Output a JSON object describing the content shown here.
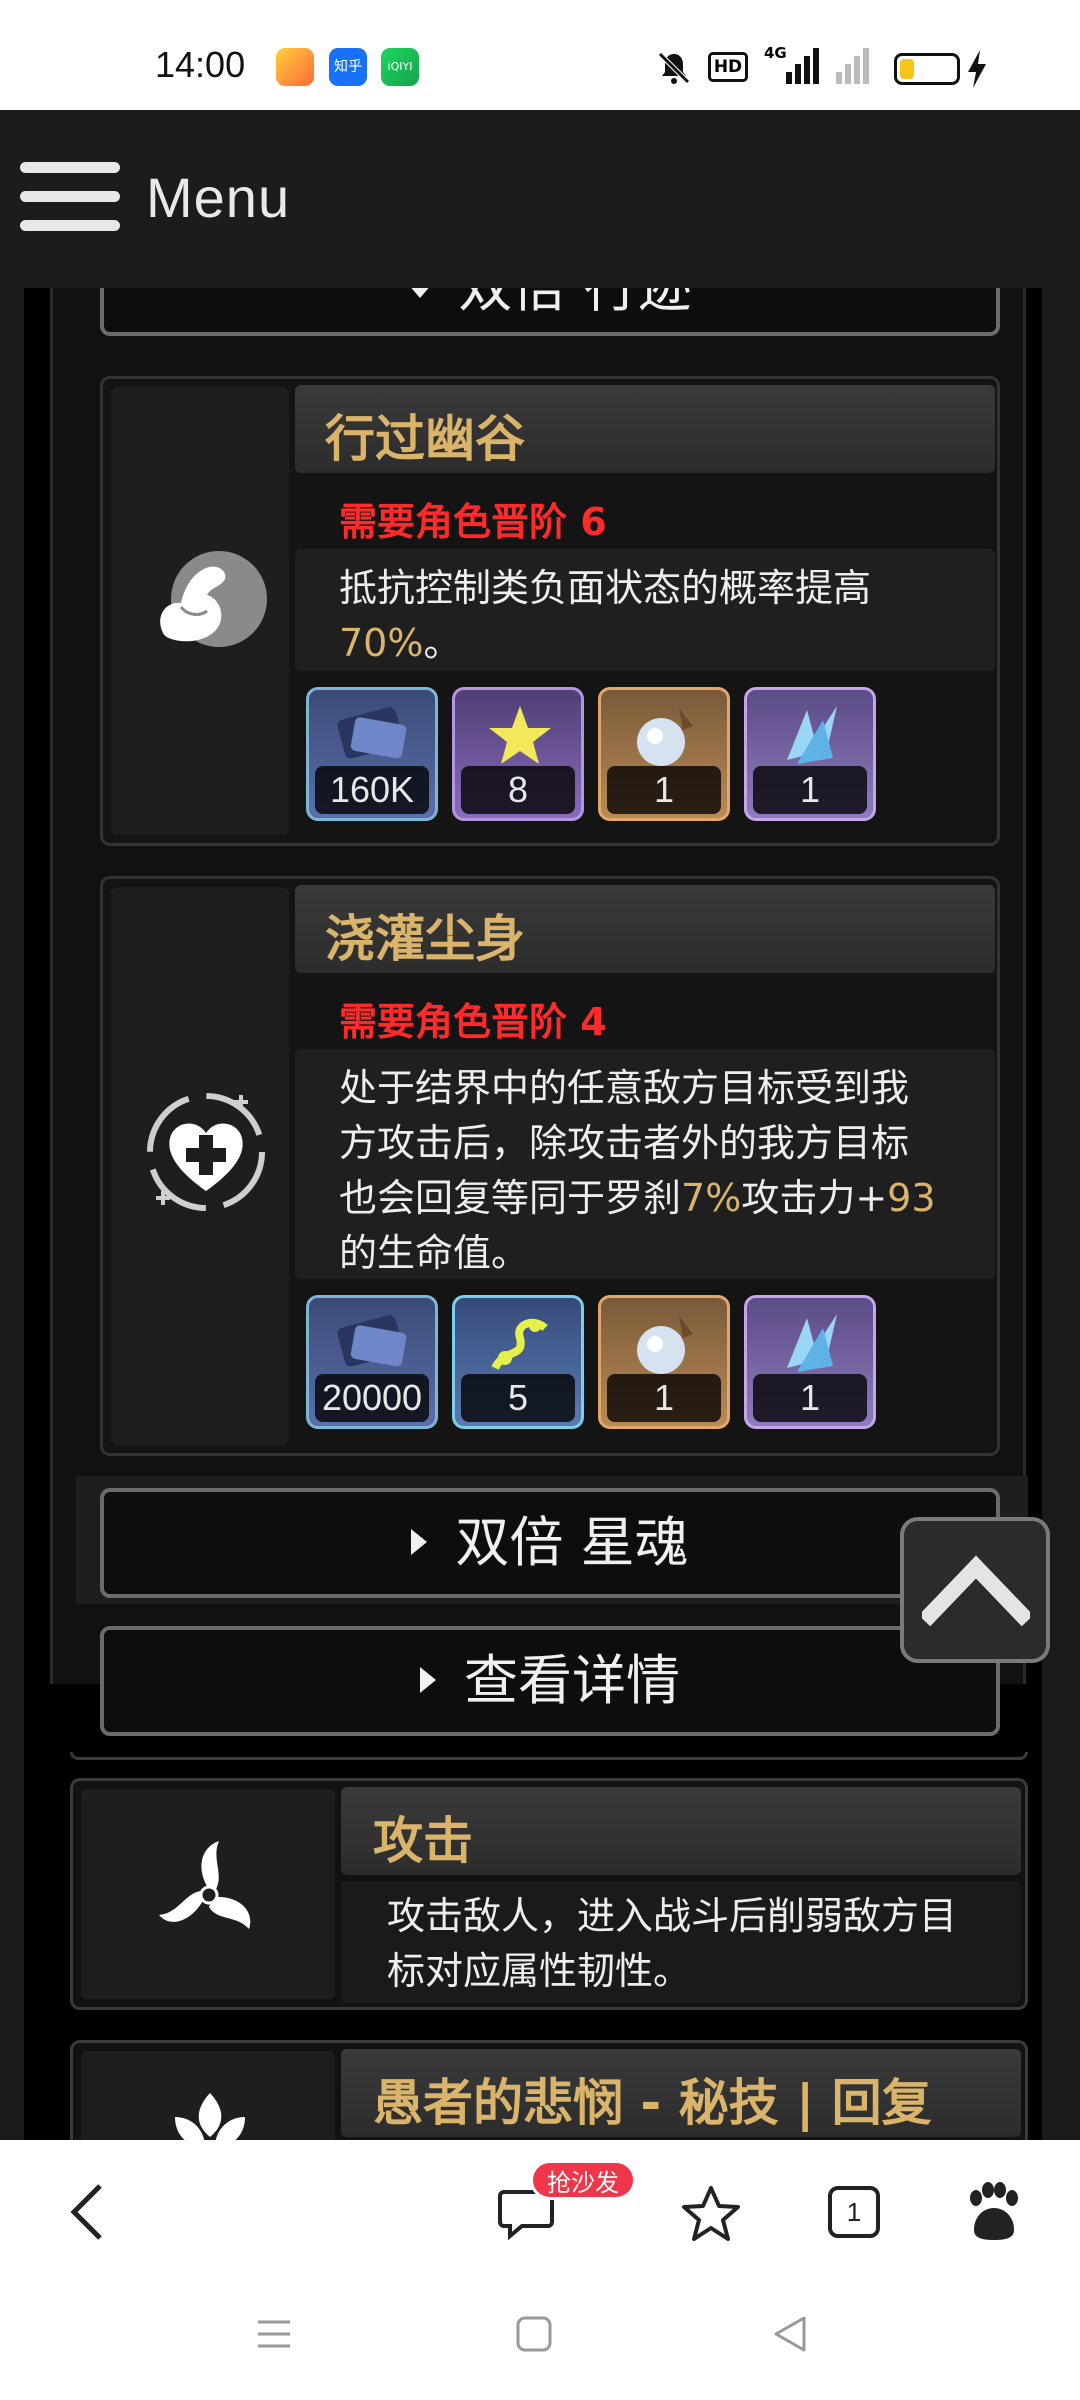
{
  "status": {
    "time": "14:00",
    "app_icons": [
      "game-app-icon",
      "zhihu-app-icon",
      "iqiyi-app-icon"
    ],
    "zhihu_label": "知乎",
    "iqiyi_label": "iQIYI",
    "hd_label": "HD",
    "network_label": "4G",
    "battery_level": 0.25
  },
  "header": {
    "menu_label": "Menu"
  },
  "sections": {
    "top_toggle_label": "双倍 行迹",
    "traces": [
      {
        "title": "行过幽谷",
        "requirement": "需要角色晋阶 6",
        "desc_parts": [
          "抵抗控制类负面状态的概率提高",
          "70%",
          "。"
        ],
        "materials": [
          "160K",
          "8",
          "1",
          "1"
        ]
      },
      {
        "title": "浇灌尘身",
        "requirement": "需要角色晋阶 4",
        "desc_line1": "处于结界中的任意敌方目标受到我",
        "desc_line2": "方攻击后，除攻击者外的我方目标",
        "desc_line3_a": "也会回复等同于罗刹",
        "desc_line3_b": "7%",
        "desc_line3_c": "攻击力+",
        "desc_line3_d": "93",
        "desc_line4": "的生命值。",
        "materials": [
          "20000",
          "5",
          "1",
          "1"
        ]
      }
    ],
    "eidolon_toggle_label": "双倍 星魂",
    "details_toggle_label": "查看详情",
    "skills": [
      {
        "title": "攻击",
        "desc_line1": "攻击敌人，进入战斗后削弱敌方目",
        "desc_line2": "标对应属性韧性。"
      },
      {
        "title": "愚者的悲悯 - 秘技 | 回复"
      }
    ]
  },
  "browser_bar": {
    "back_icon": "chevron-left-icon",
    "comment_badge": "抢沙发",
    "tab_count": "1"
  },
  "colors": {
    "gold": "#d9b46a",
    "requirement_red": "#ff2a2a",
    "badge_red": "#f0364a"
  }
}
